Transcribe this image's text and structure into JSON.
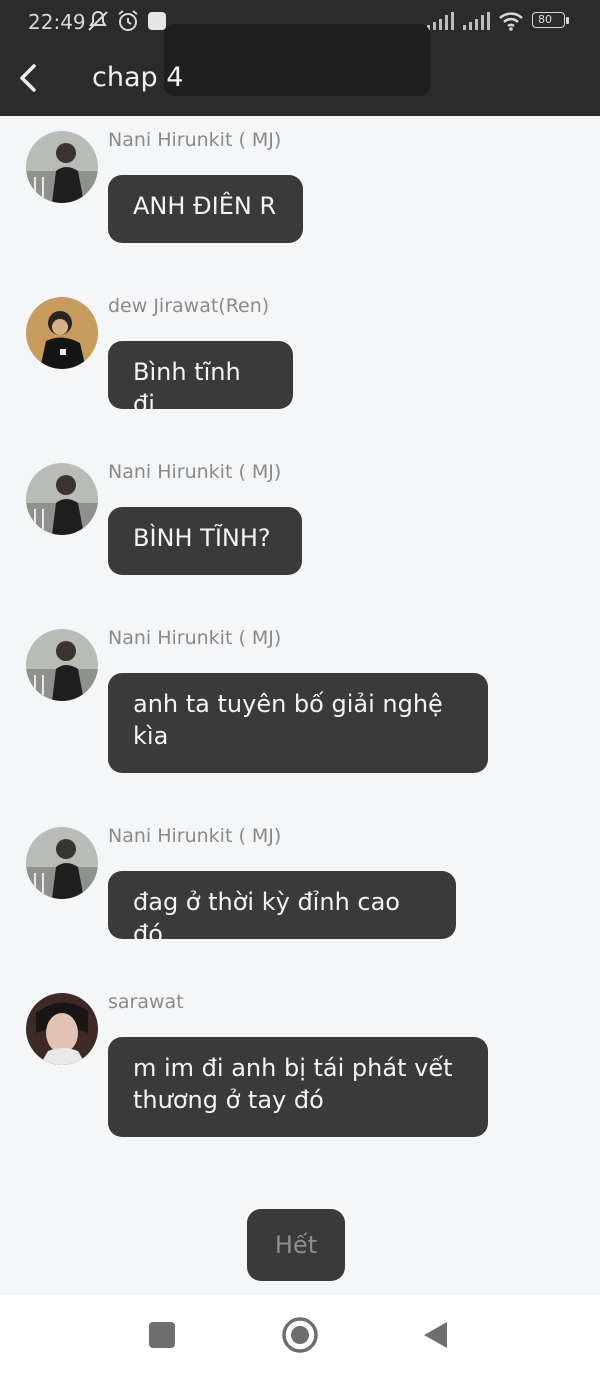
{
  "status_bar": {
    "time": "22:49",
    "battery": "80",
    "icons": [
      "mute-icon",
      "alarm-icon",
      "notification-icon",
      "signal-icon",
      "signal-icon",
      "wifi-icon",
      "battery-icon"
    ]
  },
  "header": {
    "back_icon": "chevron-left-icon",
    "title": "chap 4"
  },
  "messages": [
    {
      "sender": "Nani Hirunkit ( MJ)",
      "text": "ANH ĐIÊN R"
    },
    {
      "sender": "dew Jirawat(Ren)",
      "text": "Bình tĩnh đi"
    },
    {
      "sender": "Nani Hirunkit ( MJ)",
      "text": "BÌNH TĨNH?"
    },
    {
      "sender": "Nani Hirunkit ( MJ)",
      "text": "anh ta tuyên bố giải nghệ kìa"
    },
    {
      "sender": "Nani Hirunkit ( MJ)",
      "text": "đag ở thời kỳ đỉnh cao đó"
    },
    {
      "sender": "sarawat",
      "text": "m im đi anh bị tái phát vết thương ở tay đó"
    }
  ],
  "end_button": {
    "label": "Hết"
  },
  "nav_bar": {
    "icons": [
      "recent-apps-icon",
      "home-icon",
      "back-triangle-icon"
    ]
  },
  "colors": {
    "header_bg": "#2b2b2b",
    "page_bg": "#f5f6f8",
    "bubble_bg": "#3a3a3a",
    "bubble_text": "#f4f4f4",
    "sender_text": "#8a8a8a"
  }
}
